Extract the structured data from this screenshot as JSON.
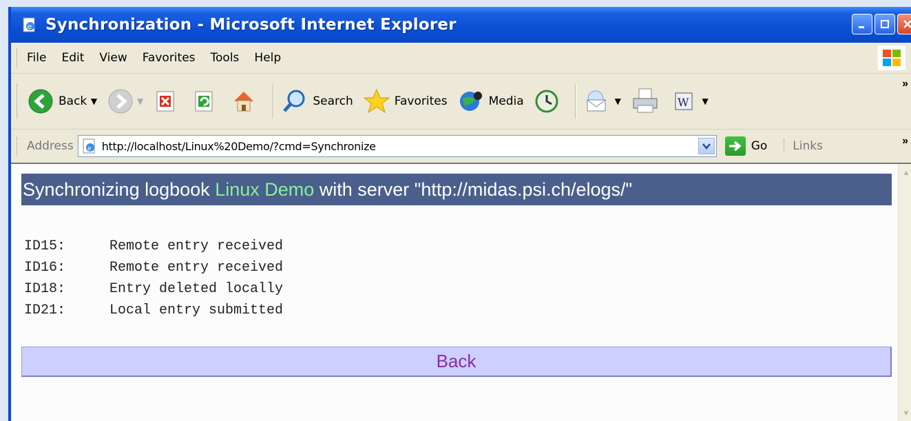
{
  "window": {
    "title": "Synchronization - Microsoft Internet Explorer"
  },
  "menu": {
    "items": [
      "File",
      "Edit",
      "View",
      "Favorites",
      "Tools",
      "Help"
    ]
  },
  "toolbar": {
    "back_label": "Back",
    "search_label": "Search",
    "favorites_label": "Favorites",
    "media_label": "Media"
  },
  "addressbar": {
    "label": "Address",
    "url": "http://localhost/Linux%20Demo/?cmd=Synchronize",
    "go_label": "Go",
    "links_label": "Links"
  },
  "page": {
    "banner_prefix": "Synchronizing logbook ",
    "banner_logbook": "Linux Demo",
    "banner_suffix": " with server \"http://midas.psi.ch/elogs/\"",
    "log": [
      {
        "id": "ID15:",
        "message": "Remote entry received"
      },
      {
        "id": "ID16:",
        "message": "Remote entry received"
      },
      {
        "id": "ID18:",
        "message": "Entry deleted locally"
      },
      {
        "id": "ID21:",
        "message": "Local entry submitted"
      }
    ],
    "back_link": "Back"
  },
  "colors": {
    "banner_bg": "#4a5f8c",
    "banner_highlight": "#89f09a",
    "back_bar_bg": "#cccfff",
    "back_link": "#8a2ea0"
  }
}
